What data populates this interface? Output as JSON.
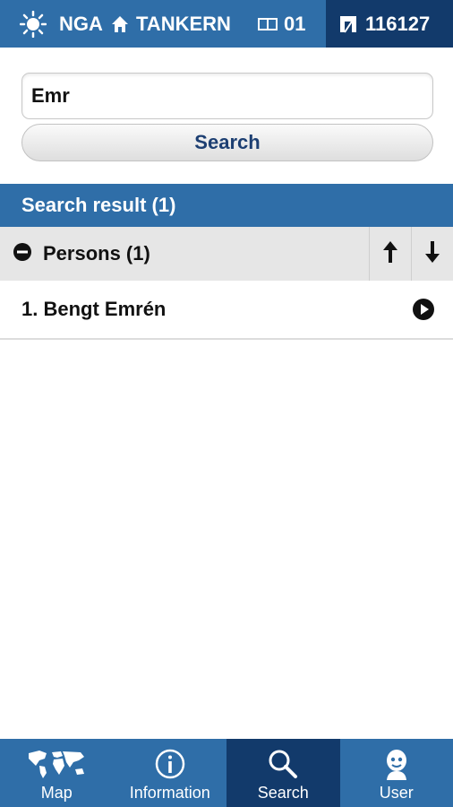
{
  "topbar": {
    "weather_label": "NGA",
    "home_label": "TANKERN",
    "counter_label": "01",
    "id_label": "116127"
  },
  "search": {
    "value": "Emr",
    "button_label": "Search"
  },
  "results": {
    "header": "Search result (1)",
    "group_label": "Persons (1)",
    "items": [
      {
        "label": "1. Bengt Emrén"
      }
    ]
  },
  "tabs": [
    {
      "label": "Map",
      "icon": "world-map-icon"
    },
    {
      "label": "Information",
      "icon": "info-icon"
    },
    {
      "label": "Search",
      "icon": "magnifier-icon",
      "active": true
    },
    {
      "label": "User",
      "icon": "user-icon"
    }
  ],
  "colors": {
    "bar_blue": "#2f6ea8",
    "active_navy": "#123a6b",
    "button_text": "#1d3f72"
  }
}
